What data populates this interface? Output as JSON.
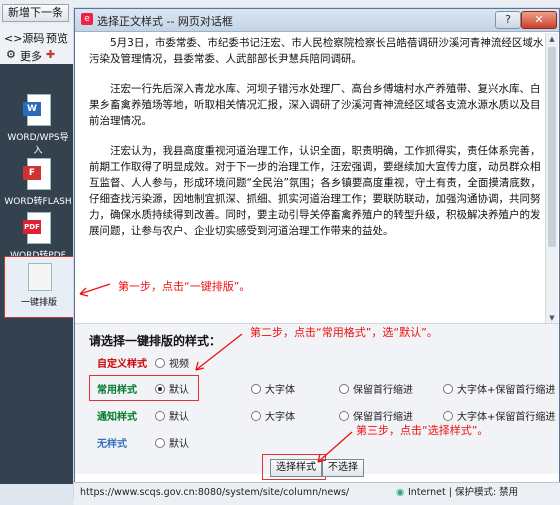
{
  "editor": {
    "btn_new": "新增下一条",
    "btn_source": "<>源码",
    "btn_preview": "预览",
    "btn_more": "更多",
    "side_items": [
      {
        "label": "WORD/WPS导入",
        "badge": "W",
        "color": "#2b6ab8"
      },
      {
        "label": "WORD转FLASH",
        "badge": "F",
        "color": "#c33"
      },
      {
        "label": "WORD转PDF",
        "badge": "PDF",
        "color": "#d23"
      },
      {
        "label": "一键排版",
        "badge": "",
        "color": "#666"
      }
    ]
  },
  "dialog": {
    "title": "选择正文样式 -- 网页对话框",
    "paragraphs": [
      "5月3日，市委常委、市纪委书记汪宏、市人民检察院检察长吕皓蓓调研沙溪河青神流经区域水污染及管理情况，县委常委、人武部部长尹慧兵陪同调研。",
      "汪宏一行先后深入青龙水库、河坝子错污水处理厂、高台乡傅塘村水产养殖带、复兴水库、白果乡畜禽养殖场等地，听取相关情况汇报，深入调研了沙溪河青神流经区域各支流水源水质以及目前治理情况。",
      "汪宏认为，我县高度重视河道治理工作，认识全面，职责明确，工作抓得实，责任体系完善，前期工作取得了明显成效。对于下一步的治理工作，汪宏强调，要继续加大宣传力度，动员群众相互监督、人人参与，形成环境问题“全民治”氛围；各乡镇要高度重视，守土有责，全面摸清底数，仔细查找污染源，因地制宜抓深、抓细、抓实河道治理工作；要联防联动，加强沟通协调，共同努力，确保水质持续得到改善。同时，要主动引导关停畜禽养殖户的转型升级，积极解决养殖户的发展问题，让参与农户、企业切实感受到河道治理工作带来的益处。"
    ],
    "panel_title": "请选择一键排版的样式：",
    "rows": [
      {
        "label": "自定义样式",
        "color": "#c00",
        "options": [
          "视频"
        ],
        "selected": -1
      },
      {
        "label": "常用样式",
        "color": "#007a2a",
        "options": [
          "默认",
          "大字体",
          "保留首行缩进",
          "大字体+保留首行缩进"
        ],
        "selected": 0
      },
      {
        "label": "通知样式",
        "color": "#007a2a",
        "options": [
          "默认",
          "大字体",
          "保留首行缩进",
          "大字体+保留首行缩进"
        ],
        "selected": -1
      },
      {
        "label": "无样式",
        "color": "#3a6fc0",
        "options": [
          "默认"
        ],
        "selected": -1
      }
    ],
    "btn_select": "选择样式",
    "btn_cancel": "不选择"
  },
  "annotations": {
    "step1": "第一步，点击“一键排版”。",
    "step2": "第二步，点击“常用格式”，选“默认”。",
    "step3": "第三步，点击“选择样式”。"
  },
  "status": {
    "url": "https://www.scqs.gov.cn:8080/system/site/column/news/",
    "zone": "Internet | 保护模式: 禁用"
  }
}
